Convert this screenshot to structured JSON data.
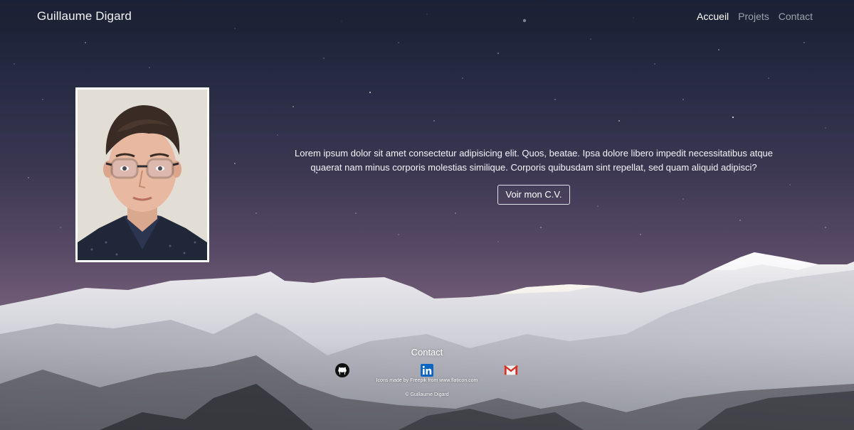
{
  "nav": {
    "brand": "Guillaume Digard",
    "links": [
      {
        "label": "Accueil",
        "active": true
      },
      {
        "label": "Projets",
        "active": false
      },
      {
        "label": "Contact",
        "active": false
      }
    ]
  },
  "hero": {
    "text": "Lorem ipsum dolor sit amet consectetur adipisicing elit. Quos, beatae. Ipsa dolore libero impedit necessitatibus atque quaerat nam minus corporis molestias similique. Corporis quibusdam sint repellat, sed quam aliquid adipisci?",
    "cv_button": "Voir mon C.V."
  },
  "footer": {
    "contact_title": "Contact",
    "socials": [
      {
        "icon": "github-icon"
      },
      {
        "icon": "linkedin-icon"
      },
      {
        "icon": "gmail-icon"
      }
    ],
    "credits": "Icons made by Freepik from www.flaticon.com",
    "copyright": "© Guillaume Digard"
  },
  "colors": {
    "nav_active": "#ffffff",
    "nav_inactive": "#9ea1ae",
    "linkedin": "#0a66c2",
    "gmail": "#d93025"
  }
}
